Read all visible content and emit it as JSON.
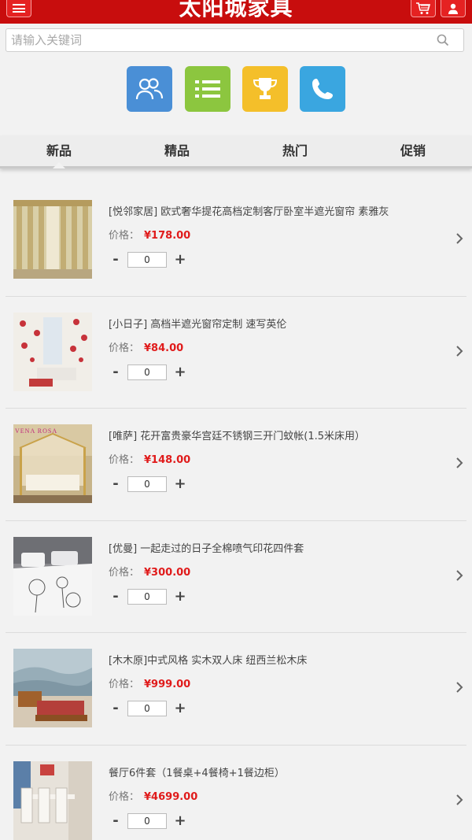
{
  "header": {
    "title": "太阳城家具"
  },
  "search": {
    "placeholder": "请输入关键词"
  },
  "quick_links": [
    {
      "icon": "users-icon",
      "color": "#4a8fd6"
    },
    {
      "icon": "list-icon",
      "color": "#8cc63f"
    },
    {
      "icon": "trophy-icon",
      "color": "#f4bf2a"
    },
    {
      "icon": "phone-icon",
      "color": "#3aa6e0"
    }
  ],
  "tabs": [
    {
      "label": "新品"
    },
    {
      "label": "精品"
    },
    {
      "label": "热门"
    },
    {
      "label": "促销"
    }
  ],
  "price_label": "价格：",
  "products": [
    {
      "name": "[悦邻家居] 欧式奢华提花高档定制客厅卧室半遮光窗帘 素雅灰",
      "price": "¥178.00",
      "qty": "0"
    },
    {
      "name": "[小日子] 高档半遮光窗帘定制 速写英伦",
      "price": "¥84.00",
      "qty": "0"
    },
    {
      "name": "[唯萨] 花开富贵豪华宫廷不锈钢三开门蚊帐(1.5米床用）",
      "price": "¥148.00",
      "qty": "0"
    },
    {
      "name": "[优曼] 一起走过的日子全棉喷气印花四件套",
      "price": "¥300.00",
      "qty": "0"
    },
    {
      "name": "[木木原]中式风格 实木双人床 纽西兰松木床",
      "price": "¥999.00",
      "qty": "0"
    },
    {
      "name": "餐厅6件套（1餐桌+4餐椅+1餐边柜）",
      "price": "¥4699.00",
      "qty": "0"
    }
  ],
  "thumb_watermark": "VENA ROSA",
  "colors": {
    "brand_red": "#c80d0d",
    "price_red": "#e01b1b"
  }
}
